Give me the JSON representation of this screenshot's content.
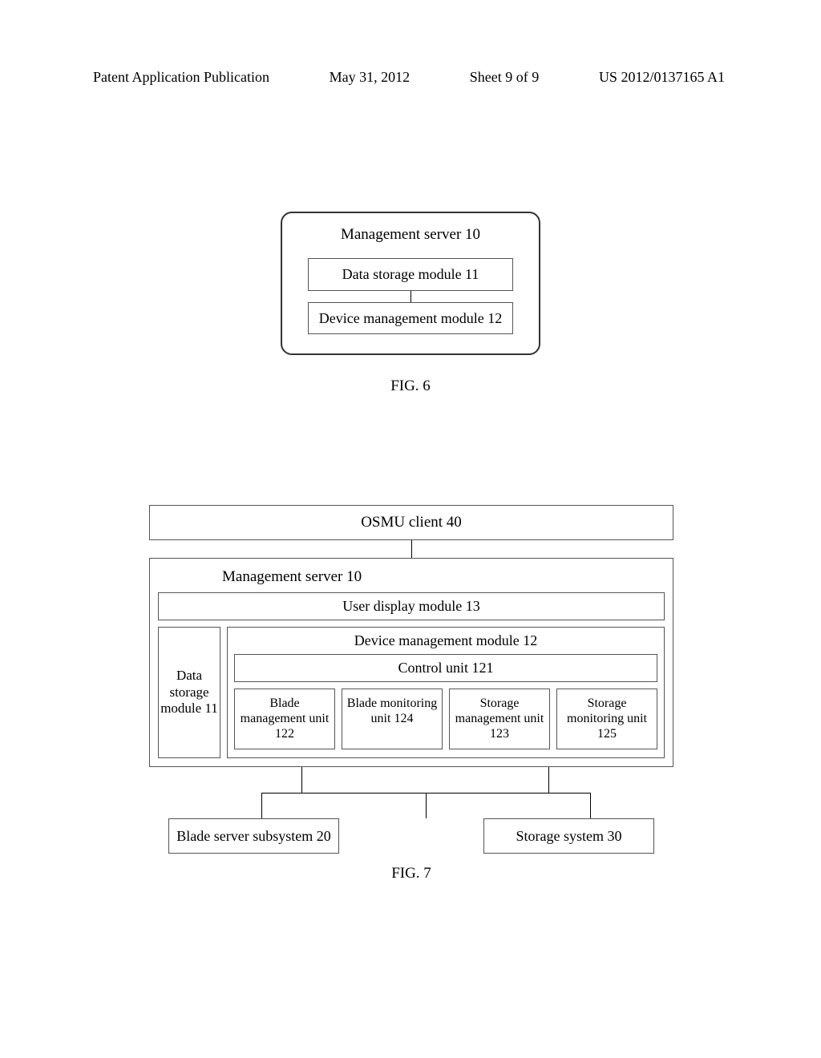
{
  "header": {
    "publication": "Patent Application Publication",
    "date": "May 31, 2012",
    "sheet": "Sheet 9 of 9",
    "number": "US 2012/0137165 A1"
  },
  "fig6": {
    "outer_title": "Management server 10",
    "box1": "Data storage module 11",
    "box2": "Device management module 12",
    "caption": "FIG. 6"
  },
  "fig7": {
    "osmu": "OSMU client 40",
    "mgmt_title": "Management server 10",
    "user_display": "User display module 13",
    "data_storage": "Data storage module 11",
    "dev_mgmt_title": "Device management module 12",
    "control_unit": "Control unit 121",
    "units": [
      "Blade management unit 122",
      "Blade monitoring unit 124",
      "Storage management unit 123",
      "Storage monitoring unit 125"
    ],
    "blade_subsystem": "Blade server subsystem 20",
    "storage_system": "Storage system 30",
    "caption": "FIG. 7"
  }
}
